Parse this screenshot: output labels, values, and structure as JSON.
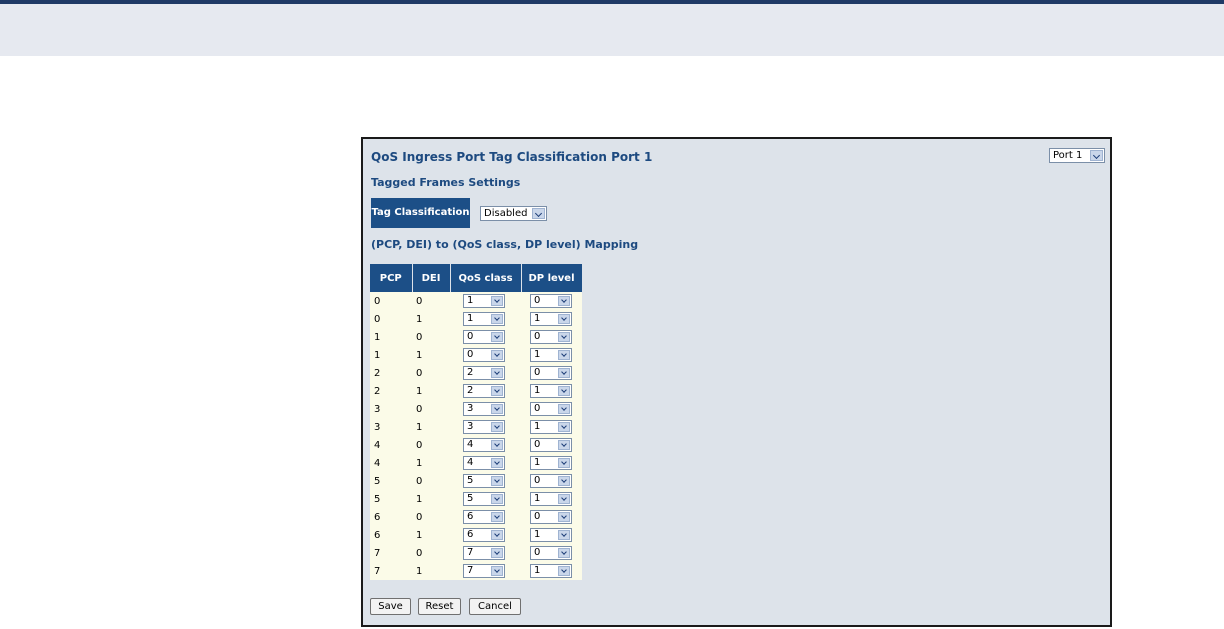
{
  "page": {
    "title": "QoS Ingress Port Tag Classification  Port 1",
    "port_select": "Port 1",
    "subtitle": "Tagged Frames Settings",
    "tag_classification_label": "Tag Classification",
    "tag_classification_value": "Disabled",
    "mapping_title": "(PCP, DEI) to (QoS class, DP level) Mapping"
  },
  "table": {
    "headers": {
      "pcp": "PCP",
      "dei": "DEI",
      "qos": "QoS class",
      "dp": "DP level"
    },
    "rows": [
      {
        "pcp": "0",
        "dei": "0",
        "qos": "1",
        "dp": "0"
      },
      {
        "pcp": "0",
        "dei": "1",
        "qos": "1",
        "dp": "1"
      },
      {
        "pcp": "1",
        "dei": "0",
        "qos": "0",
        "dp": "0"
      },
      {
        "pcp": "1",
        "dei": "1",
        "qos": "0",
        "dp": "1"
      },
      {
        "pcp": "2",
        "dei": "0",
        "qos": "2",
        "dp": "0"
      },
      {
        "pcp": "2",
        "dei": "1",
        "qos": "2",
        "dp": "1"
      },
      {
        "pcp": "3",
        "dei": "0",
        "qos": "3",
        "dp": "0"
      },
      {
        "pcp": "3",
        "dei": "1",
        "qos": "3",
        "dp": "1"
      },
      {
        "pcp": "4",
        "dei": "0",
        "qos": "4",
        "dp": "0"
      },
      {
        "pcp": "4",
        "dei": "1",
        "qos": "4",
        "dp": "1"
      },
      {
        "pcp": "5",
        "dei": "0",
        "qos": "5",
        "dp": "0"
      },
      {
        "pcp": "5",
        "dei": "1",
        "qos": "5",
        "dp": "1"
      },
      {
        "pcp": "6",
        "dei": "0",
        "qos": "6",
        "dp": "0"
      },
      {
        "pcp": "6",
        "dei": "1",
        "qos": "6",
        "dp": "1"
      },
      {
        "pcp": "7",
        "dei": "0",
        "qos": "7",
        "dp": "0"
      },
      {
        "pcp": "7",
        "dei": "1",
        "qos": "7",
        "dp": "1"
      }
    ]
  },
  "buttons": {
    "save": "Save",
    "reset": "Reset",
    "cancel": "Cancel"
  },
  "colors": {
    "header_bg": "#1c4f87",
    "title_text": "#1d4a80",
    "panel_bg": "#dde3ea",
    "cell_bg": "#fbfbe8"
  }
}
